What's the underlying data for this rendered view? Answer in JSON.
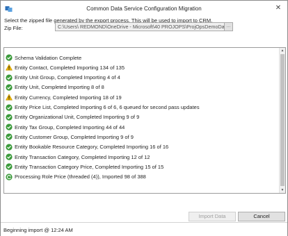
{
  "window": {
    "title": "Common Data Service Configuration Migration",
    "close_glyph": "✕"
  },
  "instruction": "Select the zipped file generated by the export process. This will be used to import to CRM.",
  "zip_file": {
    "label": "Zip File:",
    "value": "C:\\Users\\          REDMOND\\OneDrive - Microsoft\\40 PROJOPS\\ProjOpsDemoDat",
    "browse_label": "..."
  },
  "log": {
    "entries": [
      {
        "status": "success",
        "icon": "check-circle-icon",
        "text": "Schema Validation Complete"
      },
      {
        "status": "warning",
        "icon": "warning-triangle-icon",
        "text": "Entity Contact, Completed Importing 134 of 135"
      },
      {
        "status": "success",
        "icon": "check-circle-icon",
        "text": "Entity Unit Group, Completed Importing 4 of 4"
      },
      {
        "status": "success",
        "icon": "check-circle-icon",
        "text": "Entity Unit, Completed Importing 8 of 8"
      },
      {
        "status": "warning",
        "icon": "warning-triangle-icon",
        "text": "Entity Currency, Completed Importing 18 of 19"
      },
      {
        "status": "success",
        "icon": "check-circle-icon",
        "text": "Entity Price List, Completed Importing 6 of 6, 6 queued for second pass updates"
      },
      {
        "status": "success",
        "icon": "check-circle-icon",
        "text": "Entity Organizational Unit, Completed Importing 9 of 9"
      },
      {
        "status": "success",
        "icon": "check-circle-icon",
        "text": "Entity Tax Group, Completed Importing 44 of 44"
      },
      {
        "status": "success",
        "icon": "check-circle-icon",
        "text": "Entity Customer Group, Completed Importing 9 of 9"
      },
      {
        "status": "success",
        "icon": "check-circle-icon",
        "text": "Entity Bookable Resource Category, Completed Importing 16 of 16"
      },
      {
        "status": "success",
        "icon": "check-circle-icon",
        "text": "Entity Transaction Category, Completed Importing 12 of 12"
      },
      {
        "status": "success",
        "icon": "check-circle-icon",
        "text": "Entity Transaction Category Price, Completed Importing 15 of 15"
      },
      {
        "status": "progress",
        "icon": "refresh-circle-icon",
        "text": "Processing Role Price (threaded (4)), Imported 98 of 388"
      }
    ]
  },
  "buttons": {
    "import_label": "Import Data",
    "cancel_label": "Cancel"
  },
  "status": {
    "text": "Beginning import @ 12:24 AM"
  },
  "colors": {
    "success": "#3a9a3a",
    "warning": "#e8b100",
    "border": "#9b9b9b"
  }
}
